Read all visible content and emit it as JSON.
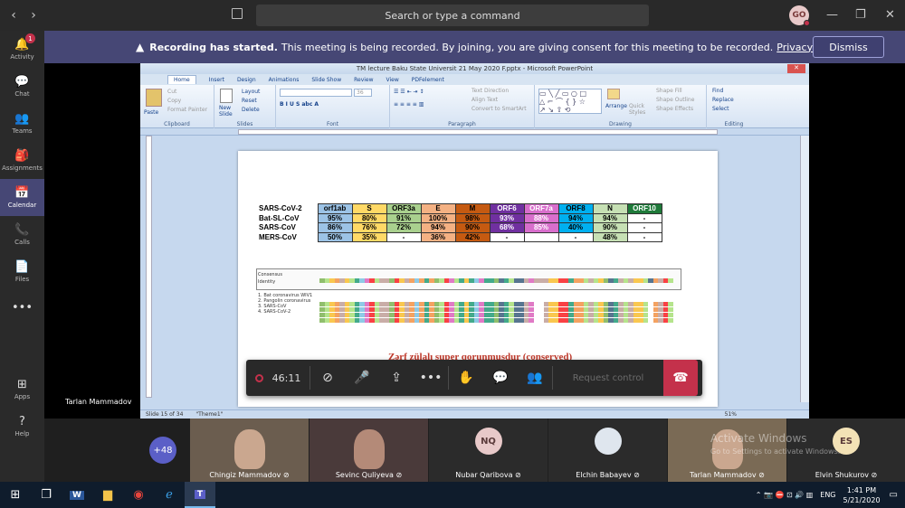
{
  "topbar": {
    "search_placeholder": "Search or type a command",
    "avatar": "GO",
    "back": "‹",
    "forward": "›"
  },
  "rail": [
    {
      "label": "Activity",
      "icon": "bell-icon",
      "glyph": "🔔",
      "badge": "1"
    },
    {
      "label": "Chat",
      "icon": "chat-icon",
      "glyph": "💬"
    },
    {
      "label": "Teams",
      "icon": "teams-icon",
      "glyph": "👥"
    },
    {
      "label": "Assignments",
      "icon": "assignments-icon",
      "glyph": "🎒"
    },
    {
      "label": "Calendar",
      "icon": "calendar-icon",
      "glyph": "📅",
      "active": true
    },
    {
      "label": "Calls",
      "icon": "phone-icon",
      "glyph": "📞"
    },
    {
      "label": "Files",
      "icon": "files-icon",
      "glyph": "📄"
    },
    {
      "label": "",
      "icon": "more-icon",
      "glyph": "•••"
    },
    {
      "label": "Apps",
      "icon": "apps-icon",
      "glyph": "⊞"
    },
    {
      "label": "Help",
      "icon": "help-icon",
      "glyph": "?"
    }
  ],
  "banner": {
    "title": "Recording has started.",
    "text": "This meeting is being recorded. By joining, you are giving consent for this meeting to be recorded.",
    "link": "Privacy policy",
    "dismiss": "Dismiss"
  },
  "ppt": {
    "title": "TM lecture Baku State Universit 21 May 2020 F.pptx - Microsoft PowerPoint",
    "tabs": [
      "Home",
      "Insert",
      "Design",
      "Animations",
      "Slide Show",
      "Review",
      "View",
      "PDFelement"
    ],
    "groups": [
      "Clipboard",
      "Slides",
      "Font",
      "Paragraph",
      "Drawing",
      "Editing"
    ],
    "ribbon_items": {
      "paste": "Paste",
      "cut": "Cut",
      "copy": "Copy",
      "format_painter": "Format Painter",
      "new_slide": "New Slide",
      "layout": "Layout",
      "reset": "Reset",
      "delete": "Delete",
      "font_size": "36",
      "text_direction": "Text Direction",
      "align_text": "Align Text",
      "convert_smartart": "Convert to SmartArt",
      "arrange": "Arrange",
      "quick_styles": "Quick Styles",
      "shape_fill": "Shape Fill",
      "shape_outline": "Shape Outline",
      "shape_effects": "Shape Effects",
      "find": "Find",
      "replace": "Replace",
      "select": "Select"
    },
    "status": {
      "slide": "Slide 15 of 34",
      "theme": "\"Theme1\"",
      "zoom": "51%"
    }
  },
  "slide": {
    "columns": [
      "orf1ab",
      "S",
      "ORF3a",
      "E",
      "M",
      "ORF6",
      "ORF7a",
      "ORF8",
      "N",
      "ORF10"
    ],
    "column_colors": [
      "#9cc3e6",
      "#ffd966",
      "#a9d08e",
      "#f4b183",
      "#c55a11",
      "#7030a0",
      "#d86ecc",
      "#00b0f0",
      "#c6e0b4",
      "#1f7a3a"
    ],
    "column_text_colors": [
      "#000",
      "#000",
      "#000",
      "#000",
      "#000",
      "#fff",
      "#fff",
      "#000",
      "#000",
      "#fff"
    ],
    "rows": [
      {
        "name": "SARS-CoV-2",
        "values": [
          "",
          "",
          "",
          "",
          "",
          "",
          "",
          "",
          "",
          ""
        ]
      },
      {
        "name": "Bat-SL-CoV",
        "values": [
          "95%",
          "80%",
          "91%",
          "100%",
          "98%",
          "93%",
          "88%",
          "94%",
          "94%",
          "-"
        ]
      },
      {
        "name": "SARS-CoV",
        "values": [
          "86%",
          "76%",
          "72%",
          "94%",
          "90%",
          "68%",
          "85%",
          "40%",
          "90%",
          "-"
        ]
      },
      {
        "name": "MERS-CoV",
        "values": [
          "50%",
          "35%",
          "-",
          "36%",
          "42%",
          "-",
          "",
          "-",
          "48%",
          "-"
        ]
      }
    ],
    "alignment_labels": [
      "Consensus",
      "Identity",
      "1. Bat coronavirus WIV1",
      "2. Pangolin coronavirus",
      "3. SARS-CoV",
      "4. SARS-CoV-2"
    ],
    "consensus_seq": "RYSFNSEAGTLENNHVSNFGFAFHYLTEASAGTAARCAYCCNTNNNSSLVKPFYNYSRMKNENSSEMPDLE",
    "footer_text": "Zərf zülalı super qorunmuşdur (conserved)"
  },
  "meeting": {
    "timer": "46:11",
    "request_control": "Request control",
    "presenter": "Tarlan Mammadov",
    "overflow_count": "+48"
  },
  "participants": [
    {
      "name": "Chingiz Mammadov",
      "initials": "",
      "video": true
    },
    {
      "name": "Sevinc Quliyeva",
      "initials": "",
      "video": true
    },
    {
      "name": "Nubar Qaribova",
      "initials": "NQ",
      "video": false,
      "color": "#e8c9c9"
    },
    {
      "name": "Elchin Babayev",
      "initials": "",
      "video": false,
      "color": "#dfe6ee"
    },
    {
      "name": "Tarlan Mammadov",
      "initials": "",
      "video": true
    },
    {
      "name": "Elvin Shukurov",
      "initials": "ES",
      "video": false,
      "color": "#f3e2b6"
    }
  ],
  "watermark": {
    "title": "Activate Windows",
    "sub": "Go to Settings to activate Windows."
  },
  "taskbar": {
    "lang": "ENG",
    "time": "1:41 PM",
    "date": "5/21/2020"
  }
}
